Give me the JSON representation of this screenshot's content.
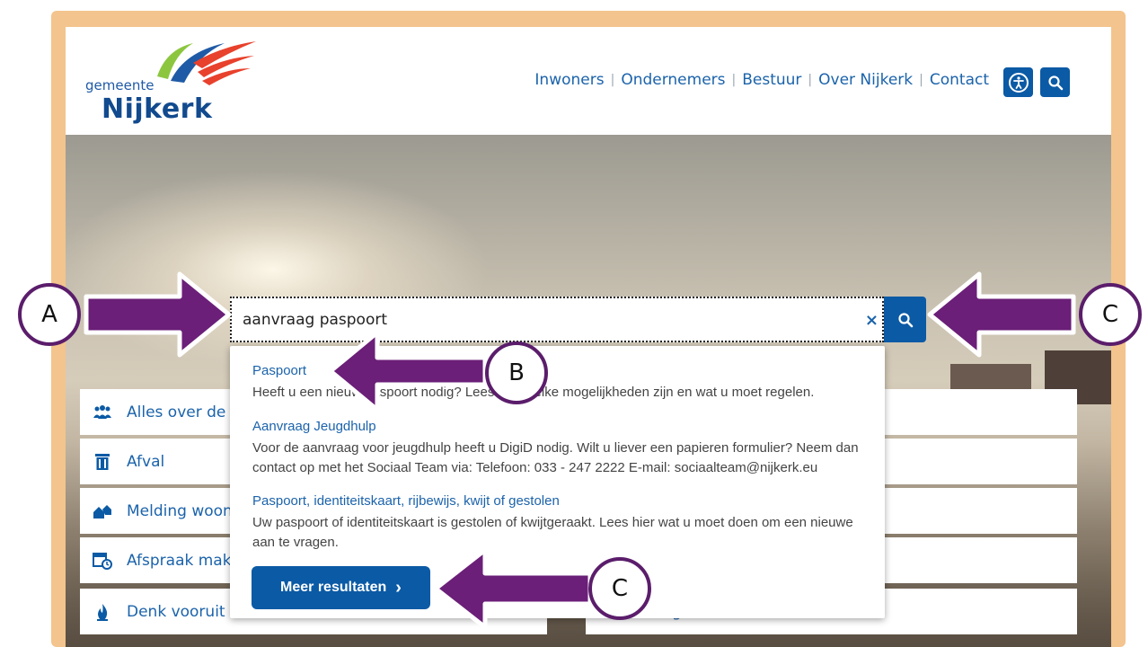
{
  "logo": {
    "small": "gemeente",
    "big": "Nijkerk"
  },
  "nav": {
    "items": [
      "Inwoners",
      "Ondernemers",
      "Bestuur",
      "Over Nijkerk",
      "Contact"
    ],
    "accessibility_icon": "accessibility-icon",
    "search_icon": "search-icon"
  },
  "search": {
    "value": "aanvraag paspoort",
    "clear_label": "×",
    "button_icon": "search-icon"
  },
  "results": [
    {
      "title": "Paspoort",
      "desc": "Heeft u een nieuw paspoort nodig? Lees hier welke mogelijkheden zijn en wat u moet regelen."
    },
    {
      "title": "Aanvraag Jeugdhulp",
      "desc": "Voor de aanvraag voor jeugdhulp heeft u DigiD nodig. Wilt u liever een papieren formulier? Neem dan contact op met het Sociaal Team via: Telefoon: 033 - 247 2222 E-mail: sociaalteam@nijkerk.eu"
    },
    {
      "title": "Paspoort, identiteitskaart, rijbewijs, kwijt of gestolen",
      "desc": "Uw paspoort of identiteitskaart is gestolen of kwijtgeraakt. Lees hier wat u moet doen om een nieuwe aan te vragen."
    }
  ],
  "more_button": "Meer resultaten",
  "more_chevron": "›",
  "tiles": [
    {
      "label": "Alles over de ge",
      "icon": "people-icon"
    },
    {
      "label": "Afval",
      "icon": "trash-icon"
    },
    {
      "label": "Melding woon- e",
      "icon": "houses-icon"
    },
    {
      "label": "Afspraak maker",
      "icon": "calendar-clock-icon"
    },
    {
      "label": "Denk vooruit",
      "icon": "flame-icon"
    }
  ],
  "right_tiles": [
    {
      "label": ""
    },
    {
      "label": ""
    },
    {
      "label": ""
    },
    {
      "label": ""
    },
    {
      "label": "g"
    }
  ],
  "callouts": {
    "a": "A",
    "b": "B",
    "c1": "C",
    "c2": "C"
  },
  "colors": {
    "brand_blue": "#0b5aa5",
    "link_blue": "#1b63ab",
    "arrow_purple": "#6b1f78",
    "frame_orange": "#f3c48d"
  }
}
